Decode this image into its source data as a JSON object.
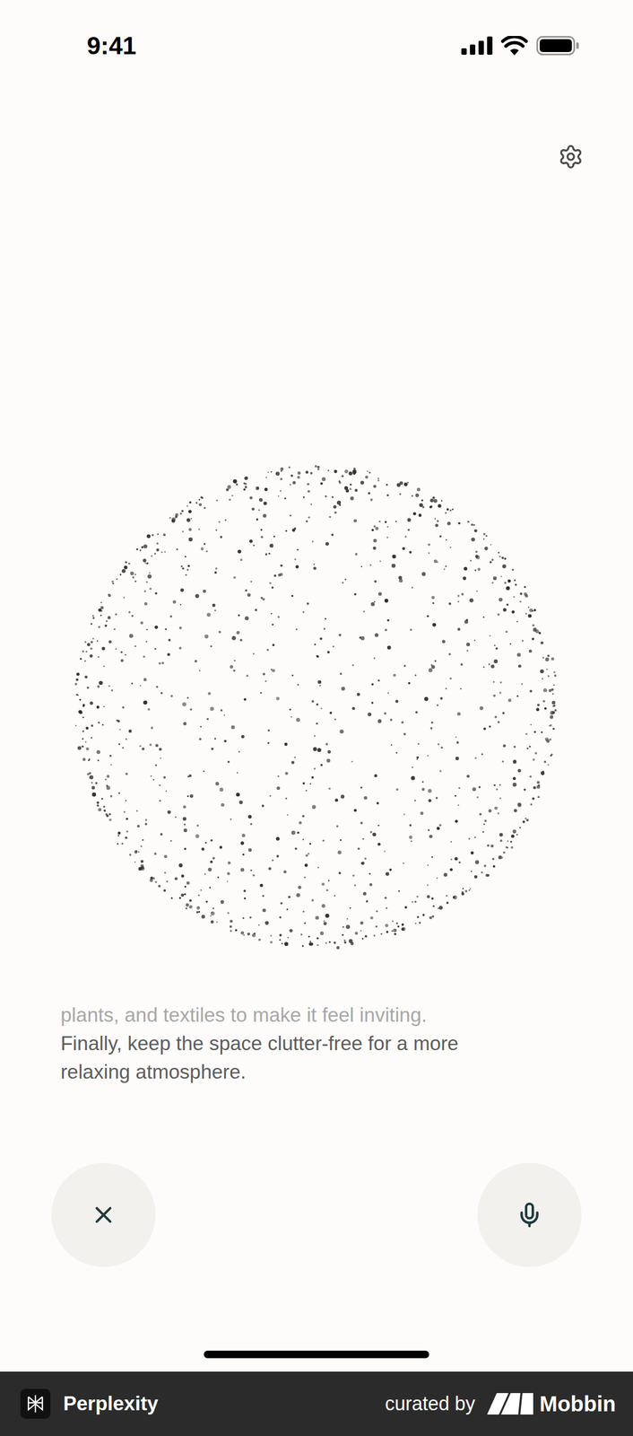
{
  "status_bar": {
    "time": "9:41"
  },
  "transcript": {
    "lines": [
      {
        "text": "plants, and textiles to make it feel inviting.",
        "faded": true
      },
      {
        "text": "Finally, keep the space clutter-free for a more",
        "faded": false
      },
      {
        "text": "relaxing atmosphere.",
        "faded": false
      }
    ]
  },
  "footer": {
    "app_name": "Perplexity",
    "curated_label": "curated by",
    "brand": "Mobbin"
  }
}
